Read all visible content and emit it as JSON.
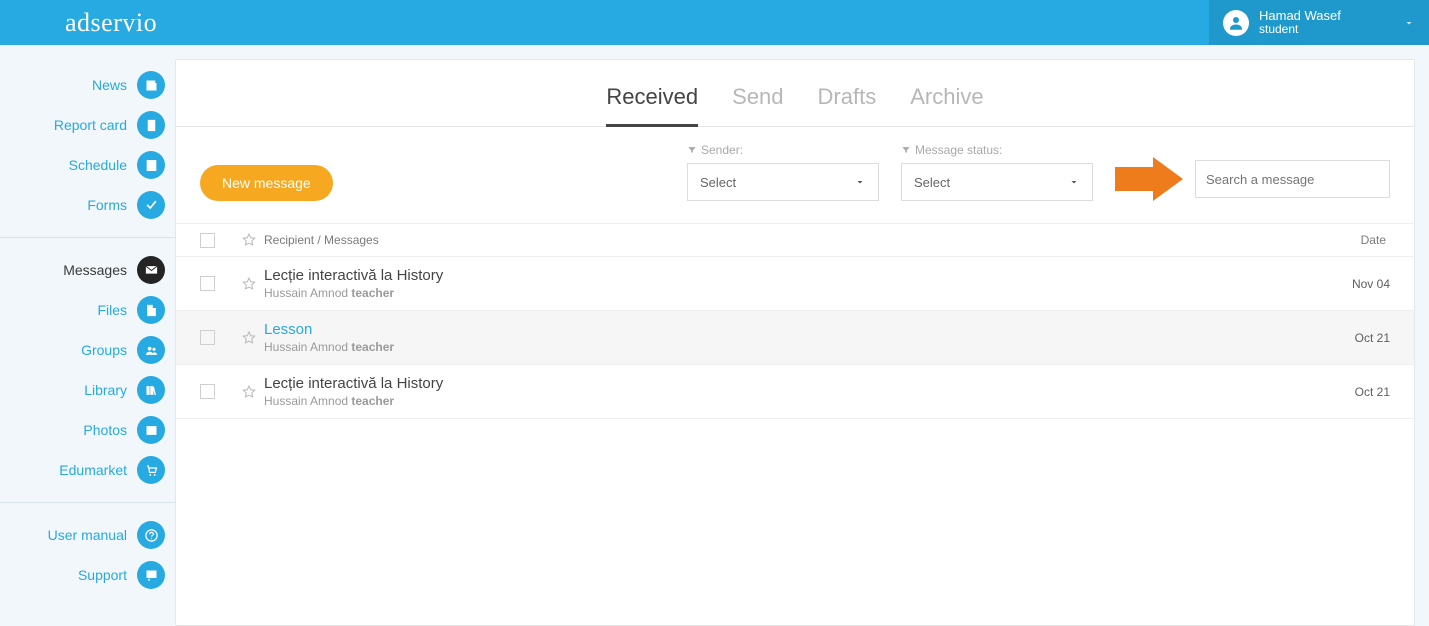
{
  "brand": "adservio",
  "user": {
    "name": "Hamad Wasef",
    "role": "student"
  },
  "sidebar": {
    "group1": [
      {
        "label": "News",
        "icon": "news"
      },
      {
        "label": "Report card",
        "icon": "report"
      },
      {
        "label": "Schedule",
        "icon": "schedule"
      },
      {
        "label": "Forms",
        "icon": "forms"
      }
    ],
    "group2": [
      {
        "label": "Messages",
        "icon": "messages",
        "active": true
      },
      {
        "label": "Files",
        "icon": "files"
      },
      {
        "label": "Groups",
        "icon": "groups"
      },
      {
        "label": "Library",
        "icon": "library"
      },
      {
        "label": "Photos",
        "icon": "photos"
      },
      {
        "label": "Edumarket",
        "icon": "cart"
      }
    ],
    "group3": [
      {
        "label": "User manual",
        "icon": "help"
      },
      {
        "label": "Support",
        "icon": "support"
      }
    ]
  },
  "tabs": [
    "Received",
    "Send",
    "Drafts",
    "Archive"
  ],
  "active_tab": "Received",
  "new_message_label": "New message",
  "filters": {
    "sender_label": "Sender:",
    "status_label": "Message status:",
    "select_text": "Select"
  },
  "search_placeholder": "Search a message",
  "list_header": {
    "recipient": "Recipient / Messages",
    "date": "Date"
  },
  "messages": [
    {
      "subject": "Lecție interactivă la History",
      "from_name": "Hussain Amnod",
      "from_role": "teacher",
      "date": "Nov 04",
      "hover": false
    },
    {
      "subject": "Lesson",
      "from_name": "Hussain Amnod",
      "from_role": "teacher",
      "date": "Oct 21",
      "hover": true
    },
    {
      "subject": "Lecție interactivă la History",
      "from_name": "Hussain Amnod",
      "from_role": "teacher",
      "date": "Oct 21",
      "hover": false
    }
  ]
}
